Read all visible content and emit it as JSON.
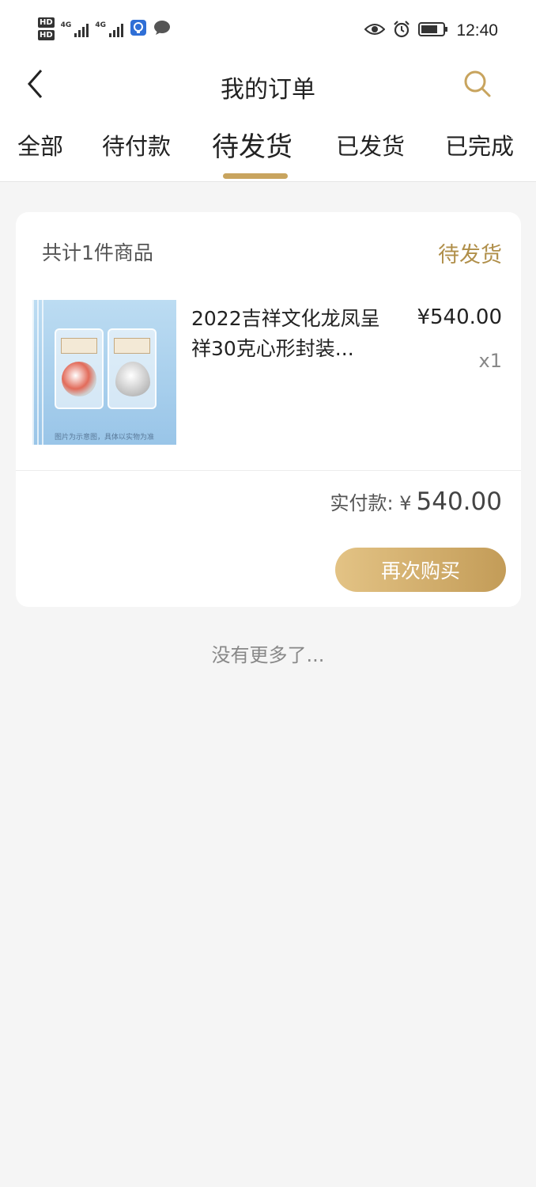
{
  "status_bar": {
    "hd1": "HD",
    "hd2": "HD",
    "sig1": "4G",
    "sig2": "4G",
    "time": "12:40"
  },
  "header": {
    "title": "我的订单"
  },
  "tabs": [
    {
      "label": "全部"
    },
    {
      "label": "待付款"
    },
    {
      "label": "待发货"
    },
    {
      "label": "已发货"
    },
    {
      "label": "已完成"
    }
  ],
  "order": {
    "count_text": "共计1件商品",
    "status": "待发货",
    "product": {
      "name": "2022吉祥文化龙凤呈祥30克心形封装...",
      "price": "¥540.00",
      "qty": "x1",
      "image_caption": "图片为示意图，具体以实物为准"
    },
    "paid_label": "实付款: ¥",
    "paid_value": "540.00",
    "rebuy_label": "再次购买"
  },
  "footer": {
    "no_more": "没有更多了..."
  },
  "colors": {
    "accent": "#c8a45e",
    "status": "#b08f4a"
  }
}
